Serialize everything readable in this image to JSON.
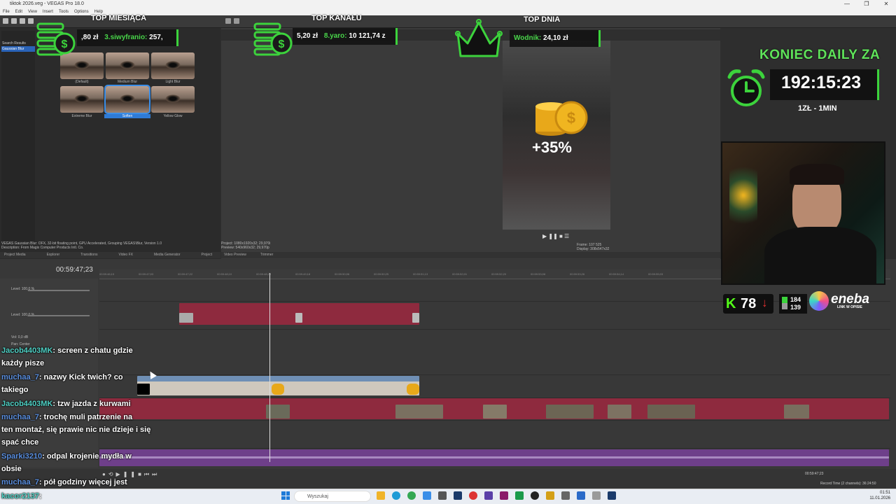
{
  "window": {
    "title": "tiktok 2026.veg - VEGAS Pro 18.0",
    "controls": [
      "—",
      "❐",
      "✕"
    ]
  },
  "menu": [
    "File",
    "Edit",
    "View",
    "Insert",
    "Tools",
    "Options",
    "Help"
  ],
  "left_panel": {
    "search_value": "ga",
    "tree": [
      "Search Results",
      "Gaussian Blur"
    ],
    "presets": [
      "(Default)",
      "Medium Blur",
      "Light Blur",
      "Extreme Blur",
      "Soften",
      "Yellow Glow"
    ],
    "selected_preset": "Soften",
    "description": [
      "VEGAS Gaussian Blur: OFX, 32-bit floating point, GPU Accelerated, Grouping VEGAS\\Blur, Version 1.0",
      "Description: From Magix Computer Products Intl. Co."
    ],
    "tabs": [
      "Project Media",
      "Explorer",
      "Transitions",
      "Video FX",
      "Media Generator",
      "Project"
    ]
  },
  "preview": {
    "info": [
      "Project:  1080x1920x32; 29,970i",
      "Preview:  540x960x32; 29,970p",
      "Video Preview"
    ],
    "frame": "Frame:   107 525",
    "display": "Display:  308x547x32",
    "tabs": [
      "Video Preview",
      "Trimmer"
    ]
  },
  "timeline": {
    "timecode": "00:59:47;23",
    "ticks": [
      "00:59:46;15",
      "00:59:47;03",
      "00:59:47;22",
      "00:59:48;10",
      "00:59:48;29",
      "00:59:49;18",
      "00:59:50;06",
      "00:59:50;25",
      "00:59:51;13",
      "00:59:52;01",
      "00:59:52;20",
      "00:59:53;08",
      "00:59:53;26",
      "00:59:54;14",
      "00:59:55;03"
    ],
    "level": "Level: 100,0 %",
    "vol": "Vol:  0,0 dB",
    "pan": "Pan:  Center",
    "end_time": "00:59:47;23",
    "record_time": "Record Time (2 channels): 36:24:50"
  },
  "overlay": {
    "top_month": {
      "title": "TOP MIESIĄCA",
      "amount": ",80 zł",
      "rank": "3.siwyfranio:",
      "value": "257,"
    },
    "top_channel": {
      "title": "TOP KANAŁU",
      "amount": "5,20 zł",
      "rank": "8.yaro:",
      "value": "10 121,74 z"
    },
    "top_day": {
      "title": "TOP DNIA",
      "name": "Wodnik:",
      "value": "24,10 zł"
    },
    "koniec": "KONIEC DAILY ZA",
    "timer": "192:15:23",
    "rate": "1ZŁ - 1MIN",
    "bonus": "+35%",
    "kick_count": "78",
    "stat_a": "184",
    "stat_b": "139",
    "sponsor": "eneba",
    "sponsor_sub": "LINK W OPISIE"
  },
  "chat": [
    {
      "user": "Jacob4403MK",
      "text": ": screen z chatu gdzie",
      "cls": "u1"
    },
    {
      "user": "",
      "text": "każdy pisze",
      "cls": ""
    },
    {
      "user": "muchaa_7",
      "text": ": nazwy Kick twich? co",
      "cls": "u2"
    },
    {
      "user": "",
      "text": "takiego",
      "cls": ""
    },
    {
      "user": "Jacob4403MK",
      "text": ": tzw jazda z kurwami",
      "cls": "u1"
    },
    {
      "user": "muchaa_7",
      "text": ": trochę muli patrzenie na",
      "cls": "u2"
    },
    {
      "user": "",
      "text": "ten montaż, się prawie nic nie dzieje i się",
      "cls": ""
    },
    {
      "user": "",
      "text": "spać chce",
      "cls": ""
    },
    {
      "user": "Sparki3210",
      "text": ": odpal krojenie mydła w",
      "cls": "u2"
    },
    {
      "user": "",
      "text": "obsie",
      "cls": ""
    },
    {
      "user": "muchaa_7",
      "text": ": pół godziny więcej jest",
      "cls": "u2"
    },
    {
      "user": "kacor2137",
      "text": ":",
      "cls": "u1"
    }
  ],
  "taskbar": {
    "search": "Wyszukaj",
    "time": "01:51",
    "date": "11.01.2026"
  }
}
